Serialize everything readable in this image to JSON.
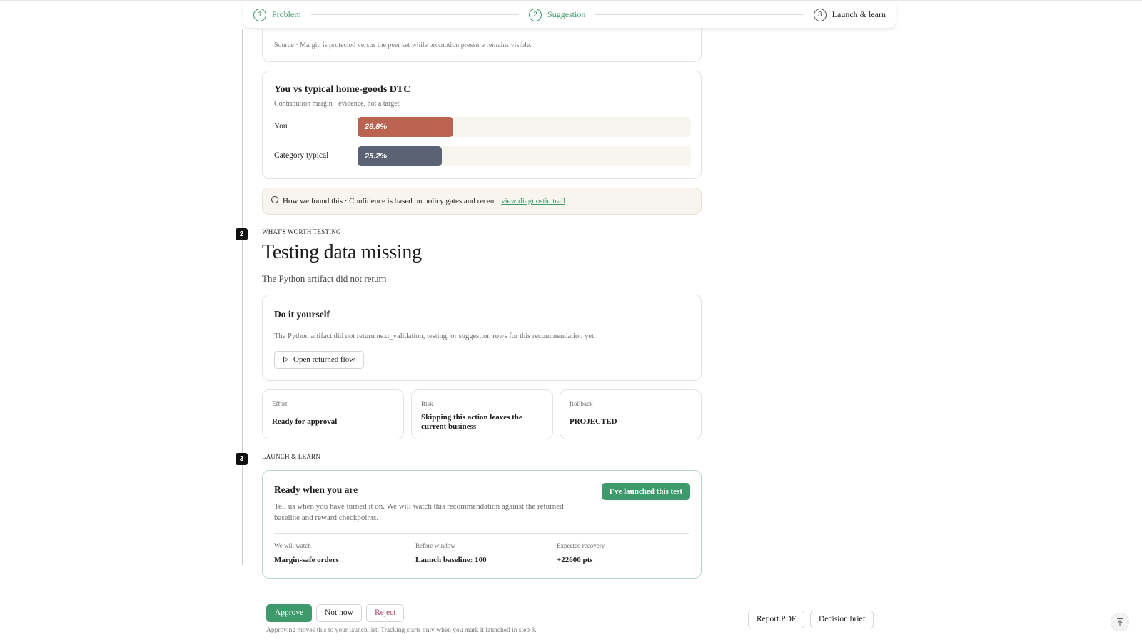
{
  "stepper": {
    "steps": [
      {
        "num": "1",
        "label": "Problem"
      },
      {
        "num": "2",
        "label": "Suggestion"
      },
      {
        "num": "3",
        "label": "Launch & learn"
      }
    ]
  },
  "source_card": {
    "source_text": "Source · Margin is protected versus the peer set while promotion pressure remains visible."
  },
  "comparison": {
    "title": "You vs typical home-goods DTC",
    "subtitle": "Contribution margin · evidence, not a target",
    "rows": [
      {
        "label": "You",
        "value": "28.8%",
        "fill_fraction": 0.288,
        "color": "#b96350"
      },
      {
        "label": "Category typical",
        "value": "25.2%",
        "fill_fraction": 0.252,
        "color": "#5b6273"
      }
    ]
  },
  "how_found": {
    "text": "How we found this · Confidence is based on policy gates and recent",
    "link": "view diagnostic trail"
  },
  "section2": {
    "badge": "2",
    "label": "WHAT'S WORTH TESTING",
    "title": "Testing data missing",
    "subtitle": "The Python artifact did not return"
  },
  "diy": {
    "title": "Do it yourself",
    "description": "The Python artifact did not return next_validation, testing, or suggestion rows for this recommendation yet.",
    "button": "Open returned flow"
  },
  "metrics": [
    {
      "key": "Effort",
      "value": "Ready for approval"
    },
    {
      "key": "Risk",
      "value": "Skipping this action leaves the current business"
    },
    {
      "key": "Rollback",
      "value": "PROJECTED"
    }
  ],
  "section3": {
    "badge": "3",
    "label": "LAUNCH & LEARN"
  },
  "ready": {
    "title": "Ready when you are",
    "description": "Tell us when you have turned it on. We will watch this recommendation against the returned baseline and reward checkpoints.",
    "button": "I've launched this test",
    "watch": [
      {
        "key": "We will watch",
        "value": "Margin-safe orders"
      },
      {
        "key": "Before window",
        "value": "Launch baseline: 100"
      },
      {
        "key": "Expected recovery",
        "value": "+22600 pts"
      }
    ]
  },
  "footer": {
    "approve": "Approve",
    "not_now": "Not now",
    "reject": "Reject",
    "note": "Approving moves this to your launch list. Tracking starts only when you mark it launched in step 3.",
    "report": "Report.PDF",
    "brief": "Decision brief"
  },
  "colors": {
    "accent_green": "#3f9a6b",
    "reject_text": "#b0476a",
    "cream": "#f8f5ee"
  }
}
